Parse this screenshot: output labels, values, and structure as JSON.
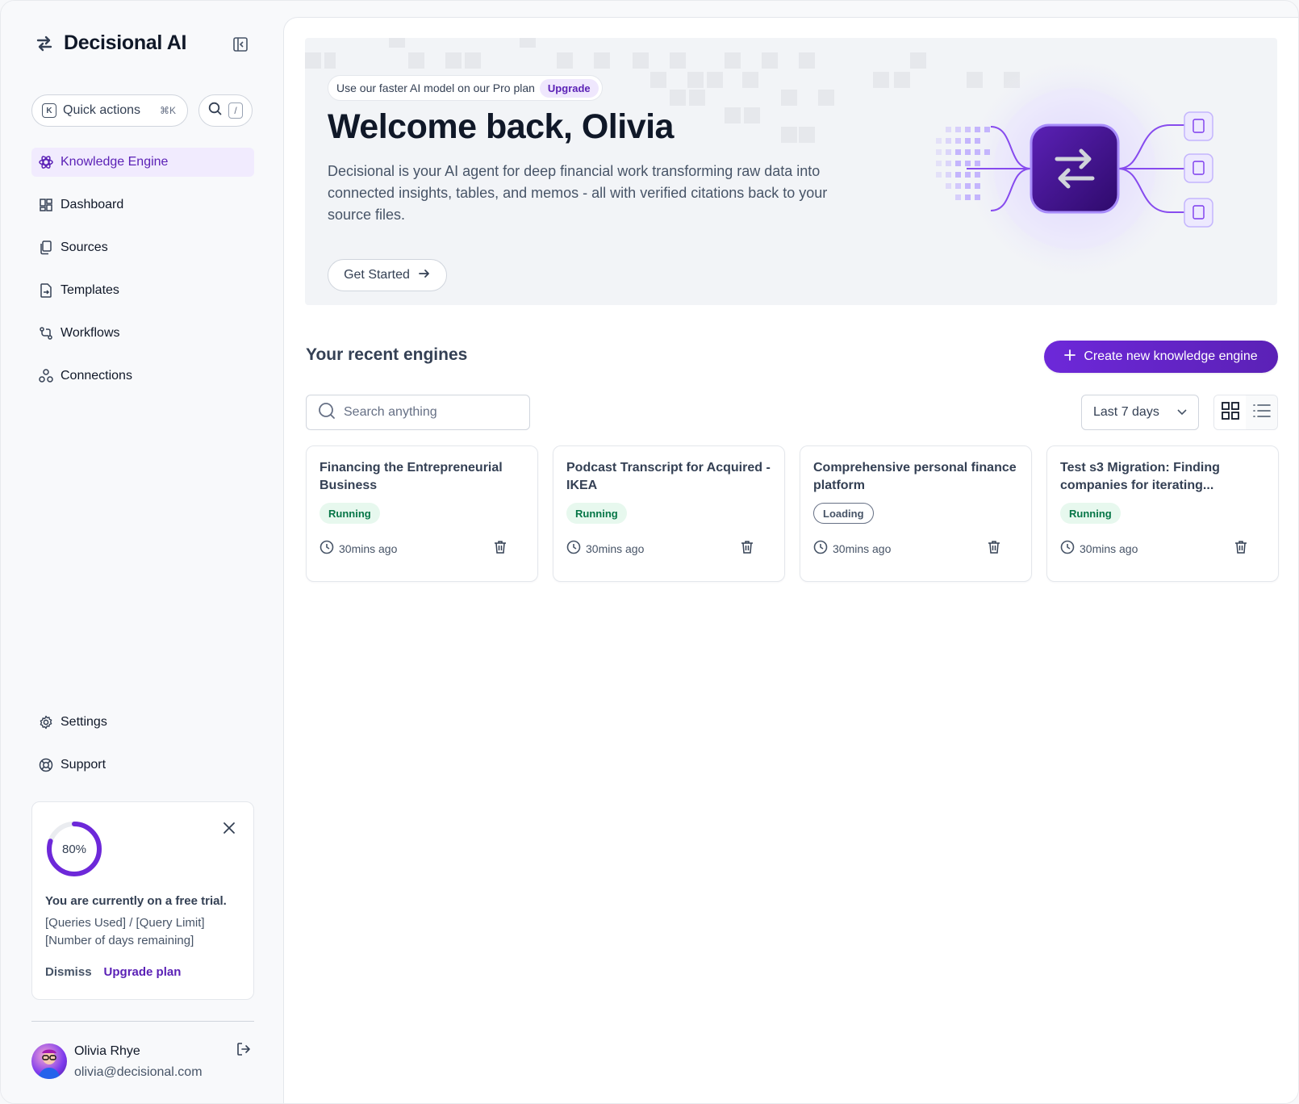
{
  "brand": {
    "name": "Decisional AI",
    "icon": "arrows-swap-icon"
  },
  "sidebar": {
    "quick_actions": {
      "label": "Quick actions",
      "key_icon": "K",
      "shortcut": "⌘K"
    },
    "search_shortcut": "/",
    "nav": [
      {
        "label": "Knowledge Engine",
        "icon": "atom-icon",
        "active": true
      },
      {
        "label": "Dashboard",
        "icon": "dashboard-icon"
      },
      {
        "label": "Sources",
        "icon": "files-icon"
      },
      {
        "label": "Templates",
        "icon": "template-icon"
      },
      {
        "label": "Workflows",
        "icon": "workflow-icon"
      },
      {
        "label": "Connections",
        "icon": "connections-icon"
      }
    ],
    "nav_bottom": [
      {
        "label": "Settings",
        "icon": "gear-icon"
      },
      {
        "label": "Support",
        "icon": "lifebuoy-icon"
      }
    ]
  },
  "trial": {
    "progress_label": "80%",
    "progress_fraction": 0.8,
    "title": "You are currently on a free trial.",
    "line1": "[Queries Used] / [Query Limit]",
    "line2": "[Number of days remaining]",
    "dismiss": "Dismiss",
    "upgrade": "Upgrade plan"
  },
  "user": {
    "name": "Olivia Rhye",
    "email": "olivia@decisional.com"
  },
  "hero": {
    "promo_text": "Use our faster AI model on our Pro plan",
    "promo_tag": "Upgrade",
    "title": "Welcome back, Olivia",
    "description": "Decisional is your AI agent for deep financial work transforming raw data into connected insights, tables, and memos - all with verified citations back to your source files.",
    "cta": "Get Started"
  },
  "engines": {
    "title": "Your recent engines",
    "create_label": "Create new knowledge engine",
    "search_placeholder": "Search anything",
    "range": "Last 7 days",
    "items": [
      {
        "title": "Financing the Entrepreneurial Business",
        "status": "Running",
        "time": "30mins ago"
      },
      {
        "title": "Podcast Transcript for Acquired - IKEA",
        "status": "Running",
        "time": "30mins ago"
      },
      {
        "title": "Comprehensive personal finance platform",
        "status": "Loading",
        "time": "30mins ago"
      },
      {
        "title": "Test s3 Migration: Finding companies for iterating...",
        "status": "Running",
        "time": "30mins ago"
      }
    ]
  },
  "colors": {
    "accent": "#5b21b6",
    "running_bg": "#e7f8ee",
    "running_fg": "#067647"
  }
}
